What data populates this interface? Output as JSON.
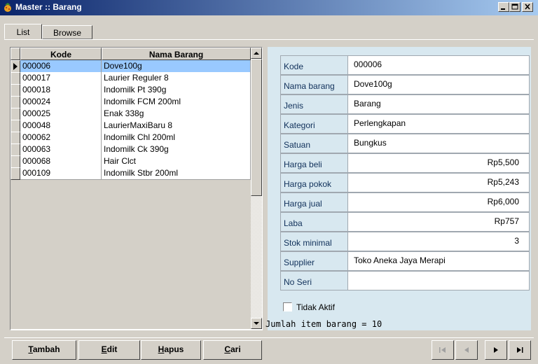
{
  "window": {
    "title": "Master :: Barang"
  },
  "tabs": [
    {
      "label": "List"
    },
    {
      "label": "Browse"
    }
  ],
  "grid": {
    "columns": [
      "Kode",
      "Nama Barang"
    ],
    "rows": [
      {
        "kode": "000006",
        "nama": "Dove100g",
        "selected": true
      },
      {
        "kode": "000017",
        "nama": "Laurier Reguler 8"
      },
      {
        "kode": "000018",
        "nama": "Indomilk Pt 390g"
      },
      {
        "kode": "000024",
        "nama": "Indomilk FCM 200ml"
      },
      {
        "kode": "000025",
        "nama": "Enak 338g"
      },
      {
        "kode": "000048",
        "nama": "LaurierMaxiBaru 8"
      },
      {
        "kode": "000062",
        "nama": "Indomilk Chl 200ml"
      },
      {
        "kode": "000063",
        "nama": "Indomilk Ck 390g"
      },
      {
        "kode": "000068",
        "nama": "Hair Clct"
      },
      {
        "kode": "000109",
        "nama": "Indomilk Stbr 200ml"
      }
    ]
  },
  "detail": {
    "fields": [
      {
        "label": "Kode",
        "value": "000006"
      },
      {
        "label": "Nama barang",
        "value": "Dove100g"
      },
      {
        "label": "Jenis",
        "value": "Barang"
      },
      {
        "label": "Kategori",
        "value": "Perlengkapan"
      },
      {
        "label": "Satuan",
        "value": "Bungkus"
      },
      {
        "label": "Harga beli",
        "value": "Rp5,500",
        "numeric": true
      },
      {
        "label": "Harga pokok",
        "value": "Rp5,243",
        "numeric": true
      },
      {
        "label": "Harga jual",
        "value": "Rp6,000",
        "numeric": true
      },
      {
        "label": "Laba",
        "value": "Rp757",
        "numeric": true
      },
      {
        "label": "Stok minimal",
        "value": "3",
        "numeric": true
      },
      {
        "label": "Supplier",
        "value": "Toko Aneka Jaya Merapi"
      },
      {
        "label": "No Seri",
        "value": ""
      }
    ],
    "tidak_aktif_label": "Tidak Aktif",
    "item_count_text": "Jumlah item barang = 10"
  },
  "buttons": {
    "tambah": {
      "hotkey": "T",
      "rest": "ambah"
    },
    "edit": {
      "hotkey": "E",
      "rest": "dit"
    },
    "hapus": {
      "hotkey": "H",
      "rest": "apus"
    },
    "cari": {
      "hotkey": "C",
      "rest": "ari"
    }
  },
  "icons": {
    "app": "app-icon",
    "minimize": "minimize-icon",
    "maximize": "maximize-icon",
    "close": "close-icon",
    "first": "first-record-icon",
    "prev": "prev-record-icon",
    "next": "next-record-icon",
    "last": "last-record-icon"
  },
  "colors": {
    "selection": "#99c9ff",
    "detail_panel": "#d8e8f0",
    "titlebar_start": "#0a246a",
    "titlebar_end": "#a6caf0"
  }
}
